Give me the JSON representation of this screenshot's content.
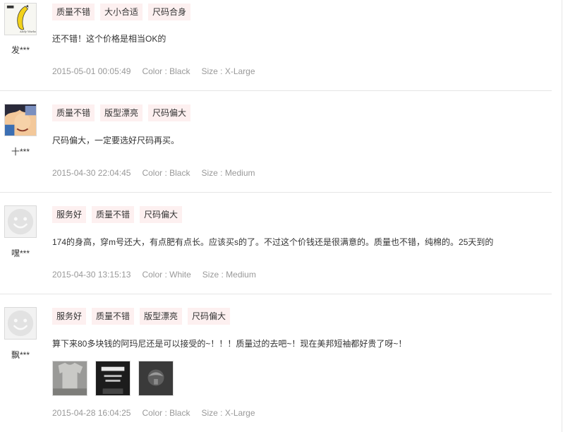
{
  "reviews": [
    {
      "username": "发***",
      "avatar_icon": "banana-art-icon",
      "tags": [
        "质量不错",
        "大小合适",
        "尺码合身"
      ],
      "comment": "还不错！这个价格是相当OK的",
      "date": "2015-05-01 00:05:49",
      "color": "Color : Black",
      "size": "Size : X-Large"
    },
    {
      "username": "十***",
      "avatar_icon": "anime-character-icon",
      "tags": [
        "质量不错",
        "版型漂亮",
        "尺码偏大"
      ],
      "comment": "尺码偏大，一定要选好尺码再买。",
      "date": "2015-04-30 22:04:45",
      "color": "Color : Black",
      "size": "Size : Medium"
    },
    {
      "username": "嘿***",
      "avatar_icon": "default-smiley-avatar-icon",
      "tags": [
        "服务好",
        "质量不错",
        "尺码偏大"
      ],
      "comment": "174的身高，穿m号还大，有点肥有点长。应该买s的了。不过这个价钱还是很满意的。质量也不错，纯棉的。25天到的",
      "date": "2015-04-30 13:15:13",
      "color": "Color : White",
      "size": "Size : Medium"
    },
    {
      "username": "飘***",
      "avatar_icon": "default-smiley-avatar-icon",
      "tags": [
        "服务好",
        "质量不错",
        "版型漂亮",
        "尺码偏大"
      ],
      "comment": "算下来80多块钱的阿玛尼还是可以接受的~！！！质量过的去吧~！现在美邦短袖都好贵了呀~！",
      "photos": [
        "tshirt-photo-thumbnail",
        "label-photo-thumbnail",
        "logo-photo-thumbnail"
      ],
      "date": "2015-04-28 16:04:25",
      "color": "Color : Black",
      "size": "Size : X-Large"
    }
  ],
  "colors": {
    "tag_bg": "#fdf0f0",
    "meta_text": "#999999",
    "divider": "#e5e5e5"
  }
}
